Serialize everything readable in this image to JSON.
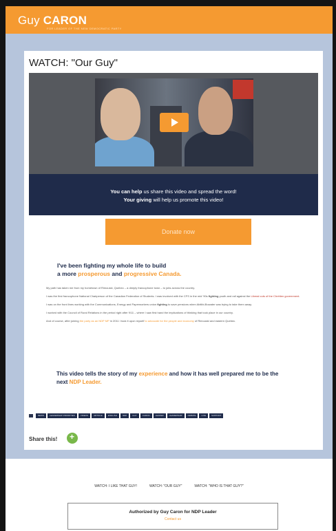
{
  "header": {
    "logo_first": "Guy",
    "logo_last": "CARON",
    "tagline": "FOR LEADER OF THE NEW DEMOCRATIC PARTY",
    "bg_color": "#f59a31"
  },
  "page": {
    "title": "WATCH: \"Our Guy\""
  },
  "video": {
    "play_icon": "play-icon"
  },
  "share_banner": {
    "line1_strong": "You can help",
    "line1_rest": " us share this video and spread the word!",
    "line2_strong": "Your giving",
    "line2_rest": " will help us promote this video!"
  },
  "donate": {
    "label": "Donate now"
  },
  "headline": {
    "line1": "I've been fighting my whole life to build",
    "line2_pre": "a more ",
    "line2_word1": "prosperous",
    "line2_mid": " and ",
    "line2_word2": "progressive Canada."
  },
  "body": {
    "p1": "My path has taken me from my hometown of Rimouski, Quebec – a deeply francophone town – to jobs across the country.",
    "p2_pre": "I was the first francophone National Chairperson of the Canadian Federation of Students. I was involved with the CFS in the mid '90s ",
    "p2_bold": "fighting",
    "p2_mid": " youth and rail against the ",
    "p2_hl": "Liberal cuts of the Chrétien government",
    "p2_end": ".",
    "p3_pre": "I was on the front lines working with the Communications, Energy and Paperworkers union ",
    "p3_bold": "fighting",
    "p3_end": " to save pensions when Abitibi-Bowater was trying to take them away.",
    "p4": "I worked with the Council of Rural Relations in the period right after 9/11 – where I saw first hand the implications of thinking that took place in our country.",
    "p5_pre": "And of course, after joining ",
    "p5_hl1": "the party as an NDP MP",
    "p5_mid": " in 2011 I took it upon myself ",
    "p5_hl2": "to advocate for the people and economy",
    "p5_end": " of Rimouski and eastern Quebec."
  },
  "closing": {
    "pre": "This video tells the story of my ",
    "hl1": "experience",
    "mid": " and how it has well prepared me to be the next ",
    "hl2": "NDP Leader."
  },
  "tags": [
    "NEWS",
    "LEADERSHIP PRIORITIES",
    "VIDEOS",
    "ARTICLE",
    "ENGLISH",
    "NDP",
    "GUY",
    "CARON",
    "LEADER",
    "LEADERSHIP",
    "DEBATE",
    "LIVE",
    "SUPPORT"
  ],
  "share": {
    "label": "Share this!",
    "icon": "share-plus-icon"
  },
  "footer": {
    "links": [
      "WATCH: I LIKE THAT GUY!",
      "WATCH: \"OUR GUY\"",
      "WATCH: \"WHO IS THAT GUY?\""
    ],
    "auth_title": "Authorized by Guy Caron for NDP Leader",
    "auth_sub": "Contact us"
  }
}
